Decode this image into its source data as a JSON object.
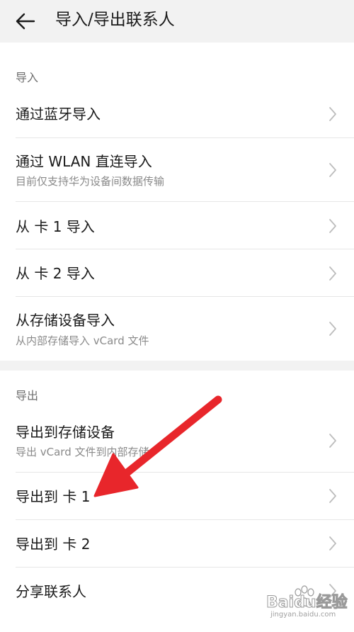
{
  "header": {
    "title": "导入/导出联系人",
    "back_icon": "arrow-left-icon"
  },
  "import_section": {
    "heading": "导入",
    "items": [
      {
        "title": "通过蓝牙导入",
        "subtitle": ""
      },
      {
        "title": "通过 WLAN 直连导入",
        "subtitle": "目前仅支持华为设备间数据传输"
      },
      {
        "title": "从 卡 1 导入",
        "subtitle": ""
      },
      {
        "title": "从 卡 2 导入",
        "subtitle": ""
      },
      {
        "title": "从存储设备导入",
        "subtitle": "从内部存储导入 vCard 文件"
      }
    ]
  },
  "export_section": {
    "heading": "导出",
    "items": [
      {
        "title": "导出到存储设备",
        "subtitle": "导出 vCard 文件到内部存储"
      },
      {
        "title": "导出到 卡 1",
        "subtitle": ""
      },
      {
        "title": "导出到 卡 2",
        "subtitle": ""
      },
      {
        "title": "分享联系人",
        "subtitle": ""
      }
    ]
  },
  "annotation": {
    "arrow_color": "#e8262b",
    "target": "导出到 卡 1"
  },
  "watermark": {
    "text": "Baidu经验",
    "sub": "jingyan.baidu.com"
  },
  "colors": {
    "header_bg": "#f2f2f2",
    "text": "#1a1a1a",
    "subtext": "#8a8a8a",
    "section_head": "#6f6f6f"
  }
}
